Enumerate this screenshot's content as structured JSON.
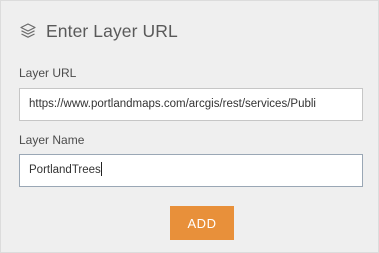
{
  "dialog": {
    "title": "Enter Layer URL",
    "icon": "layers-icon"
  },
  "layer_url": {
    "label": "Layer URL",
    "value": "https://www.portlandmaps.com/arcgis/rest/services/Publi"
  },
  "layer_name": {
    "label": "Layer Name",
    "value": "PortlandTrees"
  },
  "actions": {
    "add_label": "ADD",
    "add_color": "#e8903a"
  }
}
